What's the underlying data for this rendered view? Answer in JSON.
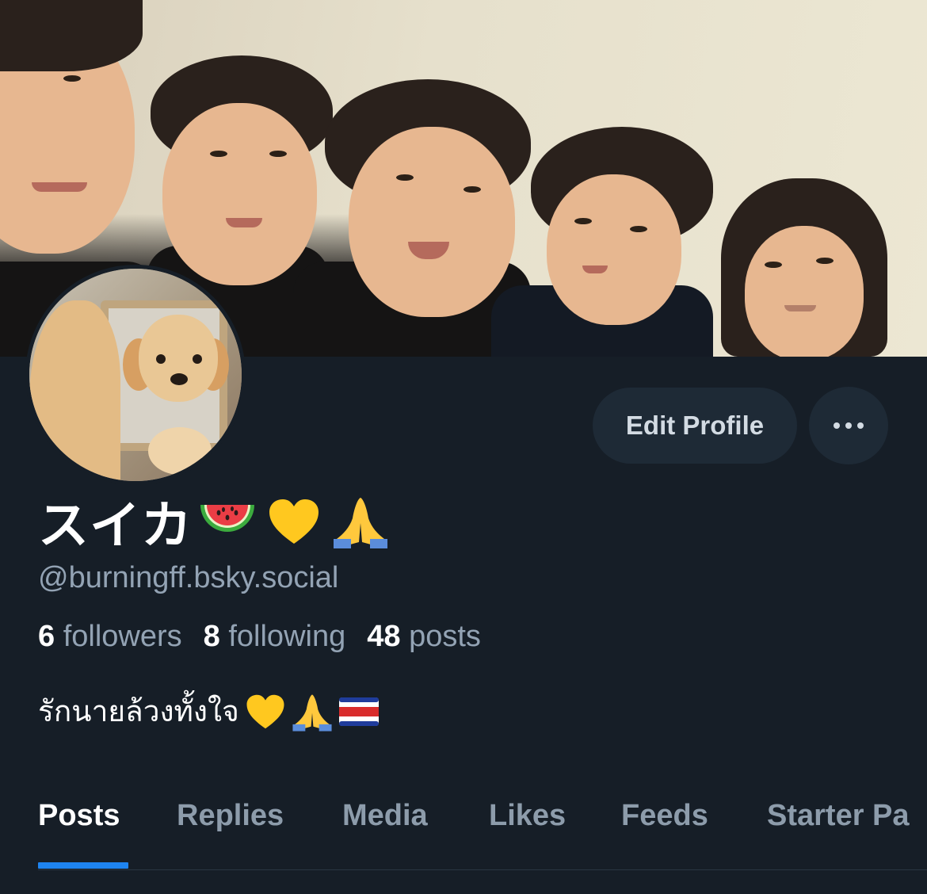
{
  "profile": {
    "display_name": "スイカ",
    "display_name_emojis": [
      "watermelon",
      "yellow-heart",
      "folded-hands"
    ],
    "handle": "@burningff.bsky.social",
    "bio_text": "รักนายล้วงทั้งใจ",
    "bio_emojis": [
      "yellow-heart",
      "folded-hands",
      "flag-costa-rica"
    ]
  },
  "stats": {
    "followers_count": "6",
    "followers_label": "followers",
    "following_count": "8",
    "following_label": "following",
    "posts_count": "48",
    "posts_label": "posts"
  },
  "actions": {
    "edit_profile_label": "Edit Profile",
    "more_icon": "ellipsis-horizontal-icon"
  },
  "tabs": [
    {
      "label": "Posts",
      "active": true
    },
    {
      "label": "Replies",
      "active": false
    },
    {
      "label": "Media",
      "active": false
    },
    {
      "label": "Likes",
      "active": false
    },
    {
      "label": "Feeds",
      "active": false
    },
    {
      "label": "Starter Pa",
      "active": false
    }
  ],
  "colors": {
    "background": "#161e27",
    "button_bg": "#1e2a36",
    "muted_text": "#93a3b4",
    "tab_indicator": "#1e84f0"
  }
}
